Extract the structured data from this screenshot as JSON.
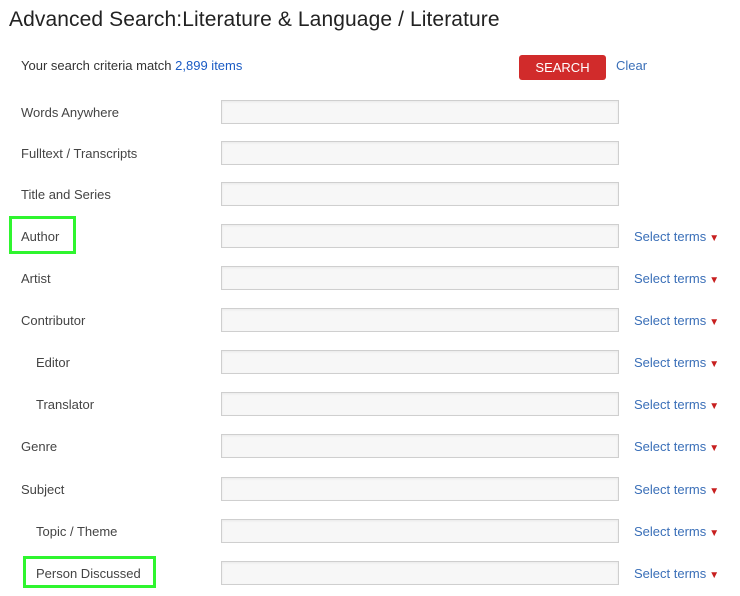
{
  "page": {
    "title": "Advanced Search:Literature & Language / Literature"
  },
  "summary": {
    "text": "Your search criteria match",
    "count": "2,899 items"
  },
  "actions": {
    "search_label": "SEARCH",
    "clear_label": "Clear"
  },
  "select_terms_label": "Select terms",
  "fields": [
    {
      "label": "Words Anywhere",
      "value": "",
      "has_terms": false
    },
    {
      "label": "Fulltext / Transcripts",
      "value": "",
      "has_terms": false
    },
    {
      "label": "Title and Series",
      "value": "",
      "has_terms": false
    },
    {
      "label": "Author",
      "value": "",
      "has_terms": true
    },
    {
      "label": "Artist",
      "value": "",
      "has_terms": true
    },
    {
      "label": "Contributor",
      "value": "",
      "has_terms": true
    },
    {
      "label": "Editor",
      "value": "",
      "has_terms": true
    },
    {
      "label": "Translator",
      "value": "",
      "has_terms": true
    },
    {
      "label": "Genre",
      "value": "",
      "has_terms": true
    },
    {
      "label": "Subject",
      "value": "",
      "has_terms": true
    },
    {
      "label": "Topic / Theme",
      "value": "",
      "has_terms": true
    },
    {
      "label": "Person Discussed",
      "value": "",
      "has_terms": true
    }
  ],
  "icons": {
    "dropdown": "caret-down-icon"
  },
  "colors": {
    "search_button": "#d12b2b",
    "link": "#3a6fb8",
    "highlight": "#2ff52f"
  }
}
